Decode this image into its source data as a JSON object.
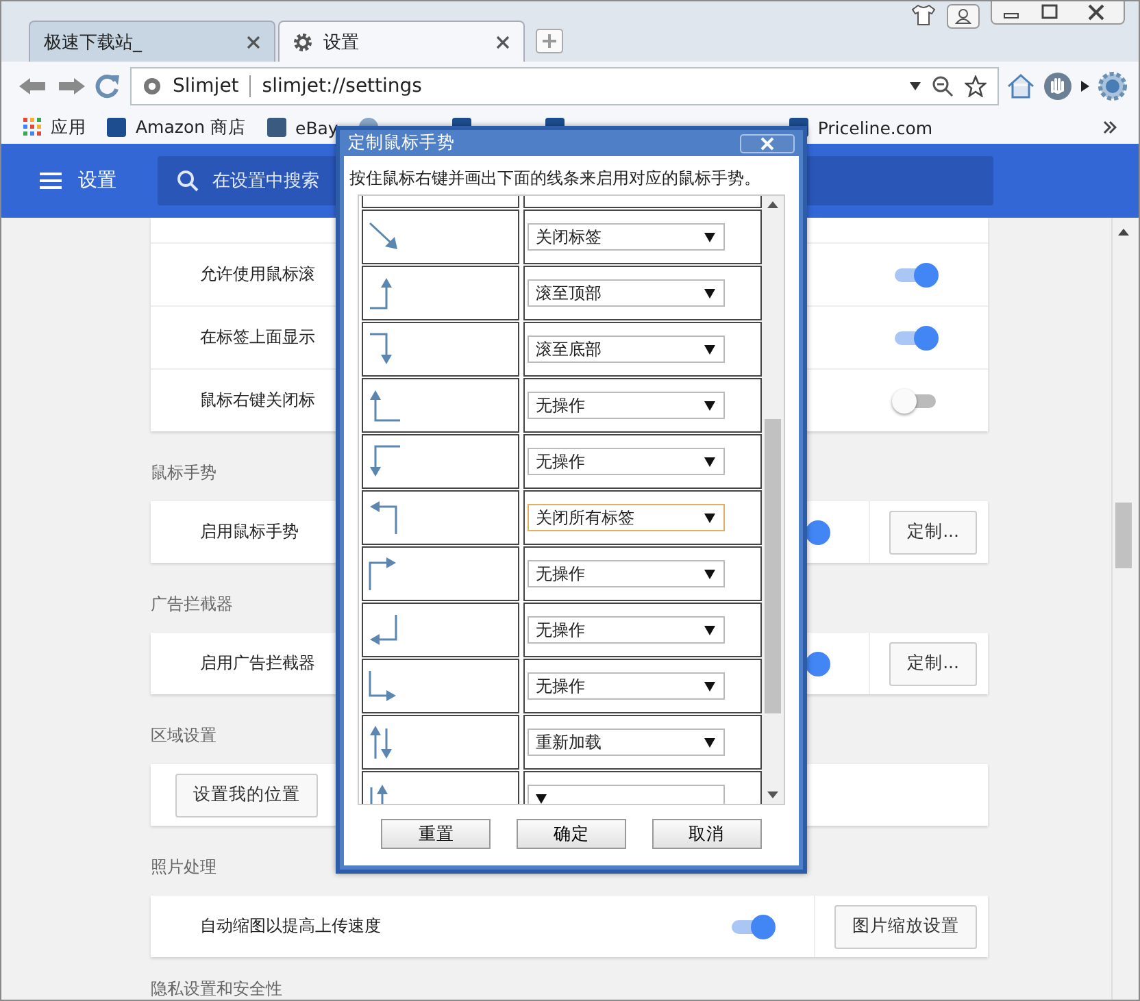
{
  "tabs": [
    {
      "title": "极速下载站_",
      "selected": false
    },
    {
      "title": "设置",
      "selected": true
    }
  ],
  "address_bar": {
    "site": "Slimjet",
    "url": "slimjet://settings"
  },
  "bookmarks": [
    "应用",
    "Amazon 商店",
    "eBay",
    "Priceline.com"
  ],
  "header": {
    "title": "设置",
    "search_placeholder": "在设置中搜索"
  },
  "sections": [
    {
      "items": [
        {
          "label": "允许使用鼠标滚",
          "on": true
        },
        {
          "label": "在标签上面显示",
          "on": true
        },
        {
          "label": "鼠标右键关闭标",
          "on": false
        }
      ]
    },
    {
      "title": "鼠标手势",
      "items": [
        {
          "label": "启用鼠标手势",
          "on": true,
          "button": "定制..."
        }
      ]
    },
    {
      "title": "广告拦截器",
      "items": [
        {
          "label": "启用广告拦截器",
          "on": true,
          "button": "定制..."
        }
      ]
    },
    {
      "title": "区域设置",
      "items": [
        {
          "button": "设置我的位置"
        }
      ]
    },
    {
      "title": "照片处理",
      "items": [
        {
          "label": "自动缩图以提高上传速度",
          "on": true,
          "button": "图片缩放设置"
        }
      ]
    },
    {
      "title": "隐私设置和安全性"
    }
  ],
  "dialog": {
    "title": "定制鼠标手势",
    "instruction": "按住鼠标右键并画出下面的线条来启用对应的鼠标手势。",
    "gestures": [
      {
        "kind": "diagonal",
        "action": "关闭标签",
        "focused": false
      },
      {
        "kind": "right-up",
        "action": "滚至顶部",
        "focused": false
      },
      {
        "kind": "right-down",
        "action": "滚至底部",
        "focused": false
      },
      {
        "kind": "left-up",
        "action": "无操作",
        "focused": false
      },
      {
        "kind": "left-down",
        "action": "无操作",
        "focused": false
      },
      {
        "kind": "up-left",
        "action": "关闭所有标签",
        "focused": true
      },
      {
        "kind": "up-right",
        "action": "无操作",
        "focused": false
      },
      {
        "kind": "down-left",
        "action": "无操作",
        "focused": false
      },
      {
        "kind": "down-right",
        "action": "无操作",
        "focused": false
      },
      {
        "kind": "up-down",
        "action": "重新加载",
        "focused": false
      },
      {
        "kind": "down-up",
        "focused": false
      }
    ],
    "buttons": [
      "重置",
      "确定",
      "取消"
    ]
  }
}
